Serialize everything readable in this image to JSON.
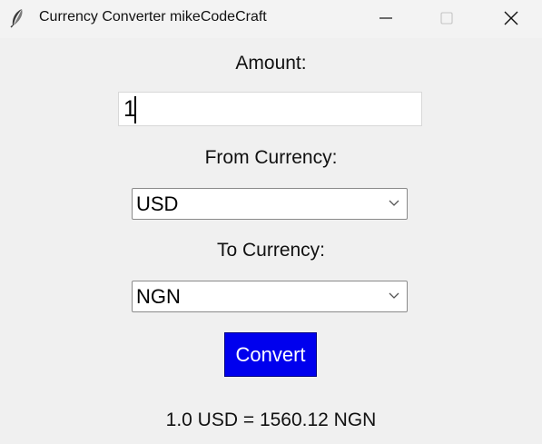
{
  "window": {
    "title": "Currency Converter mikeCodeCraft",
    "app_icon": "feather-icon",
    "controls": [
      "minimize-icon",
      "maximize-icon",
      "close-icon"
    ]
  },
  "form": {
    "amount_label": "Amount:",
    "amount_value": "1",
    "from_label": "From Currency:",
    "from_value": "USD",
    "to_label": "To Currency:",
    "to_value": "NGN",
    "convert_label": "Convert"
  },
  "result": {
    "text": "1.0 USD = 1560.12 NGN"
  },
  "colors": {
    "background": "#f0f0f0",
    "convert_button_bg": "#0000ee",
    "convert_button_text": "#ffffff"
  }
}
